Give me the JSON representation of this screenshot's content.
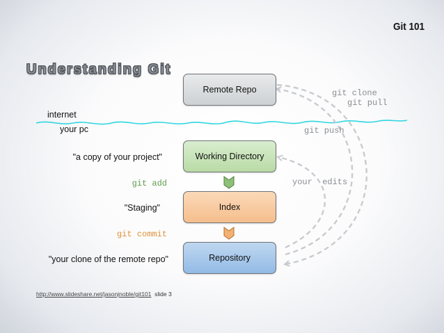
{
  "corner_title": "Git 101",
  "heading": "Understanding Git",
  "boxes": {
    "remote": "Remote Repo",
    "working": "Working Directory",
    "index": "Index",
    "repository": "Repository"
  },
  "zones": {
    "internet": "internet",
    "your_pc": "your pc"
  },
  "descriptions": {
    "working": "\"a copy of your project\"",
    "index": "\"Staging\"",
    "repository": "\"your clone of the remote repo\""
  },
  "commands": {
    "add": "git add",
    "commit": "git commit",
    "clone": "git clone",
    "pull": "git pull",
    "push": "git push",
    "edits": "your  edits"
  },
  "colors": {
    "add": "#5e9c4a",
    "commit": "#e0913a",
    "dashed_arrows": "#c8cbcf",
    "internet_line": "#2fd6e0",
    "command_text": "#8a8d91"
  },
  "footer": {
    "link": "http://www.slideshare.net/jasonjnoble/git101",
    "slide": "slide 3"
  }
}
